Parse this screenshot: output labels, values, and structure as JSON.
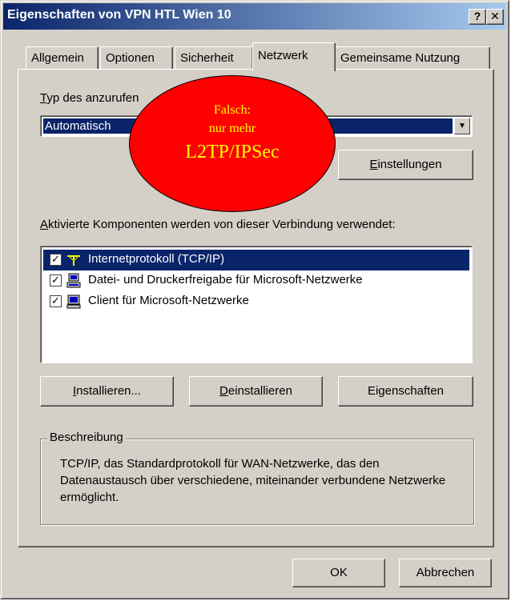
{
  "window": {
    "title": "Eigenschaften von VPN HTL Wien 10",
    "help_button": "?",
    "close_button": "✕"
  },
  "tabs": [
    {
      "label": "Allgemein",
      "active": false
    },
    {
      "label": "Optionen",
      "active": false
    },
    {
      "label": "Sicherheit",
      "active": false
    },
    {
      "label": "Netzwerk",
      "active": true
    },
    {
      "label": "Gemeinsame Nutzung",
      "active": false
    }
  ],
  "vpn_type": {
    "label_mnemonic": "T",
    "label_rest": "yp des anzurufen",
    "selected_value": "Automatisch"
  },
  "settings_button": {
    "mnemonic": "E",
    "rest": "instellungen"
  },
  "components": {
    "label_mnemonic": "A",
    "label_rest": "ktivierte Komponenten werden von dieser Verbindung verwendet:",
    "items": [
      {
        "label": "Internetprotokoll (TCP/IP)",
        "checked": true,
        "selected": true,
        "icon": "network-protocol-icon"
      },
      {
        "label": "Datei- und Druckerfreigabe für Microsoft-Netzwerke",
        "checked": true,
        "selected": false,
        "icon": "computer-printer-icon"
      },
      {
        "label": "Client für Microsoft-Netzwerke",
        "checked": true,
        "selected": false,
        "icon": "computer-icon"
      }
    ]
  },
  "actions": {
    "install": {
      "mnemonic": "I",
      "rest": "nstallieren..."
    },
    "uninstall": {
      "mnemonic": "D",
      "rest": "einstallieren"
    },
    "properties": {
      "pre": "Ei",
      "mnemonic": "g",
      "rest": "enschaften"
    }
  },
  "description": {
    "title": "Beschreibung",
    "text": "TCP/IP, das Standardprotokoll für WAN-Netzwerke, das den Datenaustausch über verschiedene, miteinander verbundene Netzwerke ermöglicht."
  },
  "footer": {
    "ok": "OK",
    "cancel": "Abbrechen"
  },
  "annotation": {
    "line1": "Falsch:",
    "line2": "nur mehr",
    "line3": "L2TP/IPSec",
    "fill_color": "#ff0000",
    "text_color": "#ffff00"
  }
}
